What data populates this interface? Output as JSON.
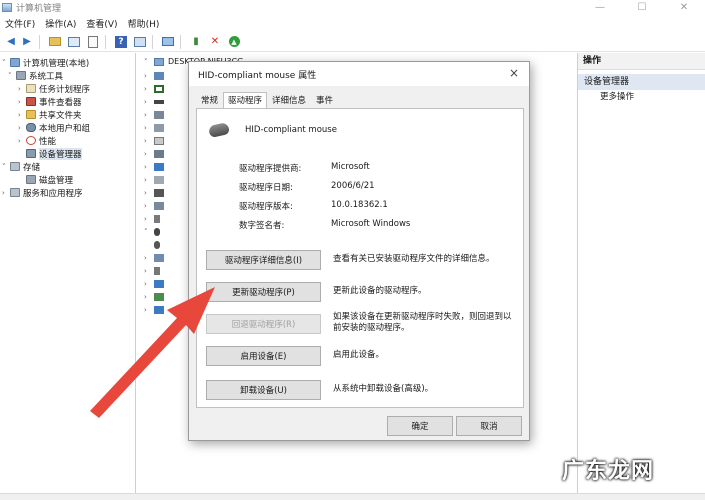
{
  "window": {
    "title": "计算机管理"
  },
  "menu": [
    "文件(F)",
    "操作(A)",
    "查看(V)",
    "帮助(H)"
  ],
  "tree": {
    "root": "计算机管理(本地)",
    "items": [
      {
        "label": "系统工具",
        "level": 1,
        "expanded": true
      },
      {
        "label": "任务计划程序",
        "level": 2
      },
      {
        "label": "事件查看器",
        "level": 2
      },
      {
        "label": "共享文件夹",
        "level": 2
      },
      {
        "label": "本地用户和组",
        "level": 2
      },
      {
        "label": "性能",
        "level": 2
      },
      {
        "label": "设备管理器",
        "level": 2,
        "selected": true
      },
      {
        "label": "存储",
        "level": 1,
        "expanded": true
      },
      {
        "label": "磁盘管理",
        "level": 2
      },
      {
        "label": "服务和应用程序",
        "level": 1
      }
    ]
  },
  "device_tree": {
    "computer": "DESKTOP-NJFU3CG"
  },
  "actions": {
    "header": "操作",
    "section": "设备管理器",
    "more": "更多操作"
  },
  "dialog": {
    "title": "HID-compliant mouse 属性",
    "tabs": [
      "常规",
      "驱动程序",
      "详细信息",
      "事件"
    ],
    "device_name": "HID-compliant mouse",
    "info": [
      {
        "label": "驱动程序提供商:",
        "value": "Microsoft"
      },
      {
        "label": "驱动程序日期:",
        "value": "2006/6/21"
      },
      {
        "label": "驱动程序版本:",
        "value": "10.0.18362.1"
      },
      {
        "label": "数字签名者:",
        "value": "Microsoft Windows"
      }
    ],
    "buttons": [
      {
        "label": "驱动程序详细信息(I)",
        "desc": "查看有关已安装驱动程序文件的详细信息。",
        "disabled": false
      },
      {
        "label": "更新驱动程序(P)",
        "desc": "更新此设备的驱动程序。",
        "disabled": false
      },
      {
        "label": "回退驱动程序(R)",
        "desc": "如果该设备在更新驱动程序时失败，则回退到以前安装的驱动程序。",
        "disabled": true
      },
      {
        "label": "启用设备(E)",
        "desc": "启用此设备。",
        "disabled": false
      },
      {
        "label": "卸载设备(U)",
        "desc": "从系统中卸载设备(高级)。",
        "disabled": false
      }
    ],
    "ok": "确定",
    "cancel": "取消"
  },
  "watermark": "广东龙网",
  "colors": {
    "arrow": "#e8473b",
    "selection": "#dde6f0",
    "dialog_bg": "#f0f0f0"
  }
}
